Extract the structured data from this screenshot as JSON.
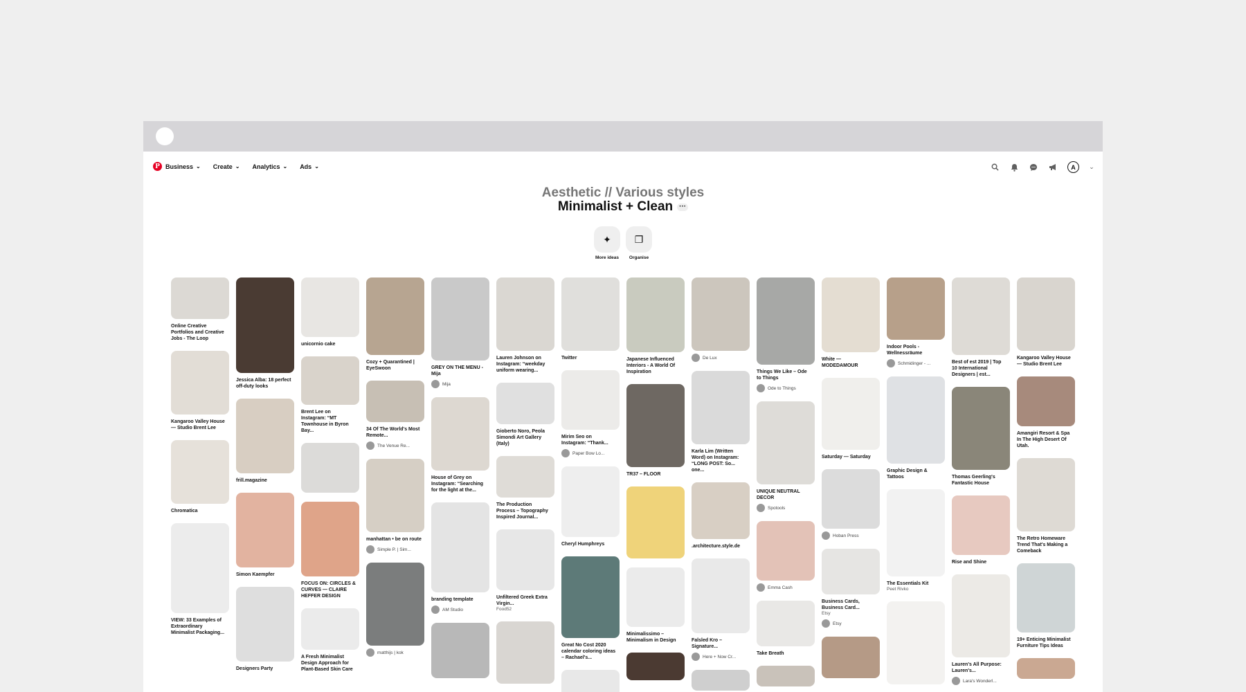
{
  "nav": {
    "logo_glyph": "P",
    "items": [
      "Business",
      "Create",
      "Analytics",
      "Ads"
    ],
    "icons": [
      "search-icon",
      "bell-icon",
      "chat-icon",
      "megaphone-icon",
      "account-avatar",
      "chevron-down-icon"
    ],
    "avatar_letter": "A"
  },
  "board": {
    "section": "Aesthetic // Various styles",
    "title": "Minimalist + Clean",
    "more": "···",
    "actions": [
      {
        "label": "More ideas",
        "icon": "sparkle-icon",
        "glyph": "✦"
      },
      {
        "label": "Organise",
        "icon": "organise-icon",
        "glyph": "❐"
      }
    ]
  },
  "columns": [
    [
      {
        "title": "Online Creative Portfolios and Creative Jobs - The Loop",
        "h": 60,
        "color": "#dcd9d4"
      },
      {
        "title": "Kangaroo Valley House — Studio Brent Lee",
        "h": 92,
        "color": "#e2ddd6"
      },
      {
        "title": "Chromatica",
        "h": 92,
        "color": "#e6e1da"
      },
      {
        "title": "VIEW: 33 Examples of Extraordinary Minimalist Packaging...",
        "h": 130,
        "color": "#ececec"
      }
    ],
    [
      {
        "title": "Jessica Alba: 18 perfect off-duty looks",
        "h": 138,
        "color": "#4a3b33"
      },
      {
        "title": "frill.magazine",
        "h": 108,
        "color": "#d8cec2"
      },
      {
        "title": "Simon Kaempfer",
        "h": 108,
        "color": "#e2b3a0"
      },
      {
        "title": "Designers Party",
        "h": 108,
        "color": "#dedede"
      }
    ],
    [
      {
        "title": "unicornio cake",
        "h": 86,
        "color": "#e8e6e3"
      },
      {
        "title": "Brent Lee on Instagram: “MT Townhouse in Byron Bay...",
        "h": 70,
        "color": "#d9d3cb"
      },
      {
        "title": "",
        "h": 72,
        "color": "#dcdbd9"
      },
      {
        "title": "FOCUS ON: CIRCLES & CURVES — CLAIRE HEFFER DESIGN",
        "h": 108,
        "color": "#dfa489"
      },
      {
        "title": "A Fresh Minimalist Design Approach for Plant-Based Skin Care",
        "h": 60,
        "color": "#ebebeb"
      }
    ],
    [
      {
        "title": "Cozy + Quarantined | EyeSwoon",
        "h": 112,
        "color": "#b7a591"
      },
      {
        "title": "34 Of The World's Most Remote...",
        "source": "The Venue Re...",
        "h": 60,
        "color": "#c7bfb4"
      },
      {
        "title": "manhattan • be on route",
        "source": "Simple P. | Sim...",
        "h": 106,
        "color": "#d6cfc5"
      },
      {
        "title": "",
        "source": "matthijs | kok",
        "h": 120,
        "color": "#7b7d7d"
      }
    ],
    [
      {
        "title": "GREY ON THE MENU - Mija",
        "source": "Mija",
        "h": 120,
        "color": "#c9c9c9"
      },
      {
        "title": "House of Grey on Instagram: “Searching for the light at the...",
        "h": 106,
        "color": "#ddd8d1"
      },
      {
        "title": "branding template",
        "source": "AM Studio",
        "h": 130,
        "color": "#e4e4e4"
      },
      {
        "title": "",
        "h": 80,
        "color": "#b8b8b8"
      }
    ],
    [
      {
        "title": "Lauren Johnson on Instagram: “weekday uniform wearing...",
        "h": 106,
        "color": "#dad7d2"
      },
      {
        "title": "Gioberto Noro, Peola Simondi Art Gallery (Italy)",
        "h": 60,
        "color": "#e0e0e0"
      },
      {
        "title": "The Production Process – Topography Inspired Journal...",
        "h": 60,
        "color": "#dfdcd7"
      },
      {
        "title": "Unfiltered Greek Extra Virgin...",
        "sub": "Food52",
        "h": 88,
        "color": "#e7e7e7"
      },
      {
        "title": "",
        "h": 90,
        "color": "#d9d6d2"
      }
    ],
    [
      {
        "title": "Twitter",
        "h": 106,
        "color": "#e0dfdc"
      },
      {
        "title": "Mirim Seo on Instagram: “Thank...",
        "source": "Paper Bow Lo...",
        "h": 86,
        "color": "#ecebe9"
      },
      {
        "title": "Cheryl Humphreys",
        "h": 102,
        "color": "#eeeeee"
      },
      {
        "title": "Great No Cost 2020 calendar coloring ideas – Rachael's...",
        "h": 118,
        "color": "#5d7a78"
      },
      {
        "title": "",
        "h": 40,
        "color": "#e8e8e8"
      }
    ],
    [
      {
        "title": "Japanese Influenced Interiors - A World Of Inspiration",
        "h": 108,
        "color": "#c9cbbf"
      },
      {
        "title": "TR37 – FLOOR",
        "h": 120,
        "color": "#6e6862"
      },
      {
        "title": "",
        "h": 104,
        "color": "#efd37a"
      },
      {
        "title": "Minimalissimo – Minimalism in Design",
        "h": 86,
        "color": "#ebebeb"
      },
      {
        "title": "",
        "h": 40,
        "color": "#4b3a32"
      }
    ],
    [
      {
        "title": "",
        "source": "De Lux",
        "h": 106,
        "color": "#ccc6bd"
      },
      {
        "title": "Karla Lim (Written Word) on Instagram: “LONG POST: So... one...",
        "h": 106,
        "color": "#dadada"
      },
      {
        "title": ".architecture.style.de",
        "h": 82,
        "color": "#d8cfc4"
      },
      {
        "title": "Falsled Kro – Signature...",
        "source": "Here + Now Cr...",
        "h": 108,
        "color": "#e9e9e9"
      },
      {
        "title": "",
        "h": 30,
        "color": "#cfcfcf"
      }
    ],
    [
      {
        "title": "Things We Like – Ode to Things",
        "source": "Ode to Things",
        "h": 126,
        "color": "#a7a8a6"
      },
      {
        "title": "UNIQUE NEUTRAL DECOR",
        "source": "Spotools",
        "h": 120,
        "color": "#dedcd8"
      },
      {
        "title": "",
        "source": "Emma Cash",
        "h": 86,
        "color": "#e3c2b7"
      },
      {
        "title": "Take Breath",
        "h": 66,
        "color": "#e9e8e6"
      },
      {
        "title": "",
        "h": 30,
        "color": "#c9c2ba"
      }
    ],
    [
      {
        "title": "White — MODEDAMOUR",
        "h": 108,
        "color": "#e4ddd2"
      },
      {
        "title": "Saturday — Saturday",
        "h": 104,
        "color": "#f0efec"
      },
      {
        "title": "",
        "source": "Hoban Press",
        "h": 86,
        "color": "#dcdcdc"
      },
      {
        "title": "Business Cards, Business Card...",
        "sub": "Etsy",
        "source": "Etsy",
        "h": 66,
        "color": "#e6e5e3"
      },
      {
        "title": "",
        "h": 60,
        "color": "#b59a86"
      }
    ],
    [
      {
        "title": "Indoor Pools - Wellnessräume",
        "source": "Schmidinger - ...",
        "h": 90,
        "color": "#b7a08a"
      },
      {
        "title": "Graphic Design & Tattoos",
        "h": 126,
        "color": "#dfe1e4"
      },
      {
        "title": "The Essentials Kit",
        "sub": "Peet Rivko",
        "h": 126,
        "color": "#f2f2f2"
      },
      {
        "title": "",
        "h": 120,
        "color": "#f3f2f0"
      }
    ],
    [
      {
        "title": "Best of est 2019 | Top 10 International Designers | est...",
        "h": 112,
        "color": "#dedbd6"
      },
      {
        "title": "Thomas Geerling's Fantastic House",
        "h": 120,
        "color": "#8a8679"
      },
      {
        "title": "Rise and Shine",
        "h": 86,
        "color": "#e7c9c0"
      },
      {
        "title": "Lauren's All Purpose: Lauren's...",
        "source": "Lara's Wonderl...",
        "h": 120,
        "color": "#eceae6"
      },
      {
        "title": "",
        "h": 30,
        "color": "#e0d0c6"
      }
    ],
    [
      {
        "title": "Kangaroo Valley House — Studio Brent Lee",
        "h": 106,
        "color": "#d9d5cf"
      },
      {
        "title": "Amangiri Resort & Spa In The High Desert Of Utah.",
        "h": 72,
        "color": "#a78a7c"
      },
      {
        "title": "The Retro Homeware Trend That's Making a Comeback",
        "h": 106,
        "color": "#dedad4"
      },
      {
        "title": "19+ Enticing Minimalist Furniture Tips Ideas",
        "h": 100,
        "color": "#cfd5d6"
      },
      {
        "title": "",
        "h": 30,
        "color": "#caa892"
      }
    ]
  ]
}
